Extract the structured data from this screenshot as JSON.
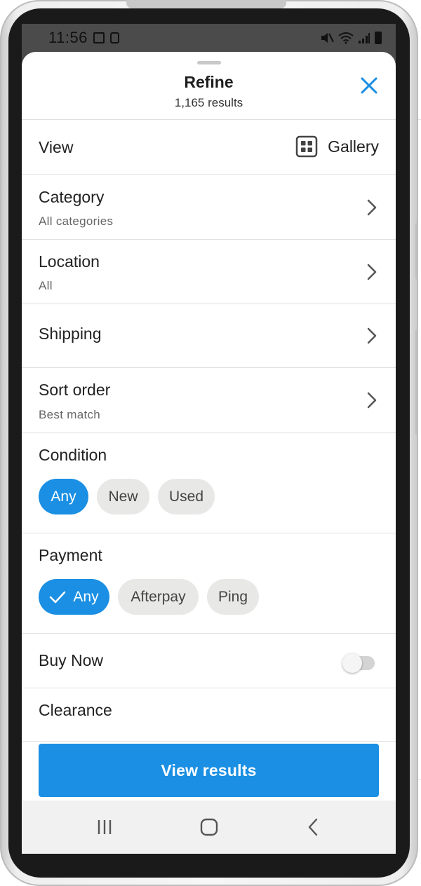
{
  "status_bar": {
    "time": "11:56"
  },
  "sheet": {
    "title": "Refine",
    "subtitle": "1,165 results"
  },
  "view_row": {
    "label": "View",
    "value": "Gallery"
  },
  "rows": [
    {
      "label": "Category",
      "sub": "All categories"
    },
    {
      "label": "Location",
      "sub": "All"
    },
    {
      "label": "Shipping",
      "sub": ""
    },
    {
      "label": "Sort order",
      "sub": "Best match"
    }
  ],
  "condition": {
    "label": "Condition",
    "options": [
      "Any",
      "New",
      "Used"
    ],
    "selected": "Any"
  },
  "payment": {
    "label": "Payment",
    "options": [
      "Any",
      "Afterpay",
      "Ping"
    ],
    "selected": "Any"
  },
  "buy_now": {
    "label": "Buy Now",
    "enabled": false
  },
  "clearance": {
    "label": "Clearance"
  },
  "footer": {
    "button_label": "View results"
  },
  "colors": {
    "accent": "#1a8fe3",
    "chip_bg": "#e8e8e6",
    "divider": "#e0e0e0"
  }
}
